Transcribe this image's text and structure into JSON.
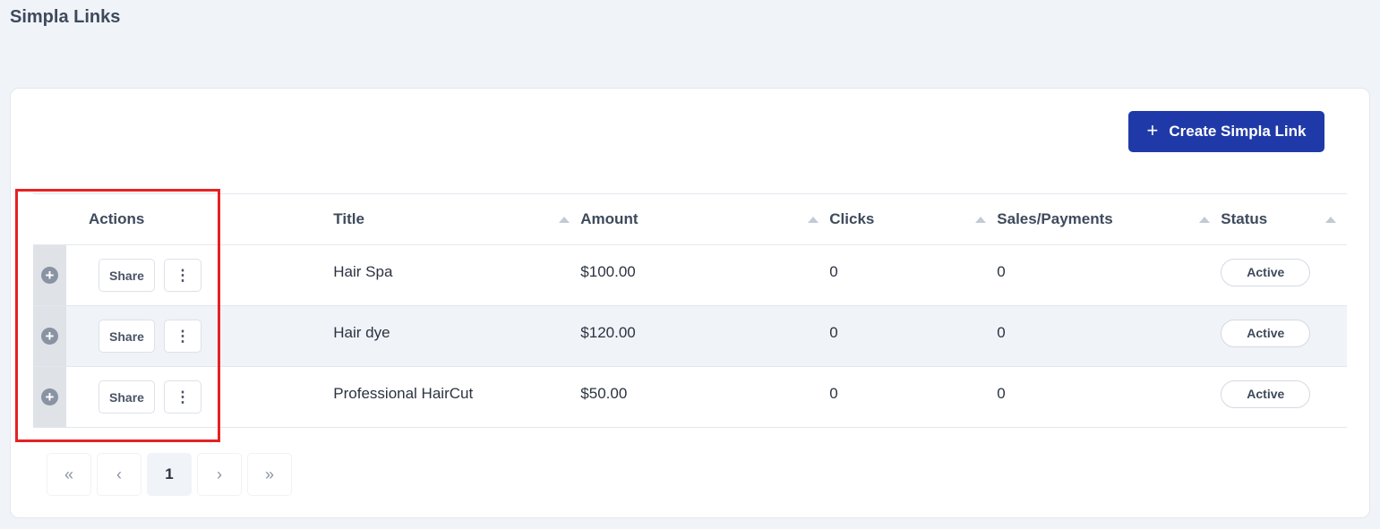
{
  "page": {
    "title": "Simpla Links"
  },
  "toolbar": {
    "create_label": "Create Simpla Link",
    "create_icon": "plus-icon"
  },
  "table": {
    "columns": [
      "Actions",
      "Title",
      "Amount",
      "Clicks",
      "Sales/Payments",
      "Status"
    ],
    "rows": [
      {
        "title": "Hair Spa",
        "amount": "$100.00",
        "clicks": "0",
        "sales": "0",
        "status": "Active",
        "share": "Share"
      },
      {
        "title": "Hair dye",
        "amount": "$120.00",
        "clicks": "0",
        "sales": "0",
        "status": "Active",
        "share": "Share"
      },
      {
        "title": "Professional HairCut",
        "amount": "$50.00",
        "clicks": "0",
        "sales": "0",
        "status": "Active",
        "share": "Share"
      }
    ]
  },
  "pagination": {
    "first": "«",
    "prev": "‹",
    "current": "1",
    "next": "›",
    "last": "»"
  },
  "colors": {
    "primary": "#1f3aa8",
    "highlight": "#e52222",
    "background": "#f0f3f8"
  }
}
